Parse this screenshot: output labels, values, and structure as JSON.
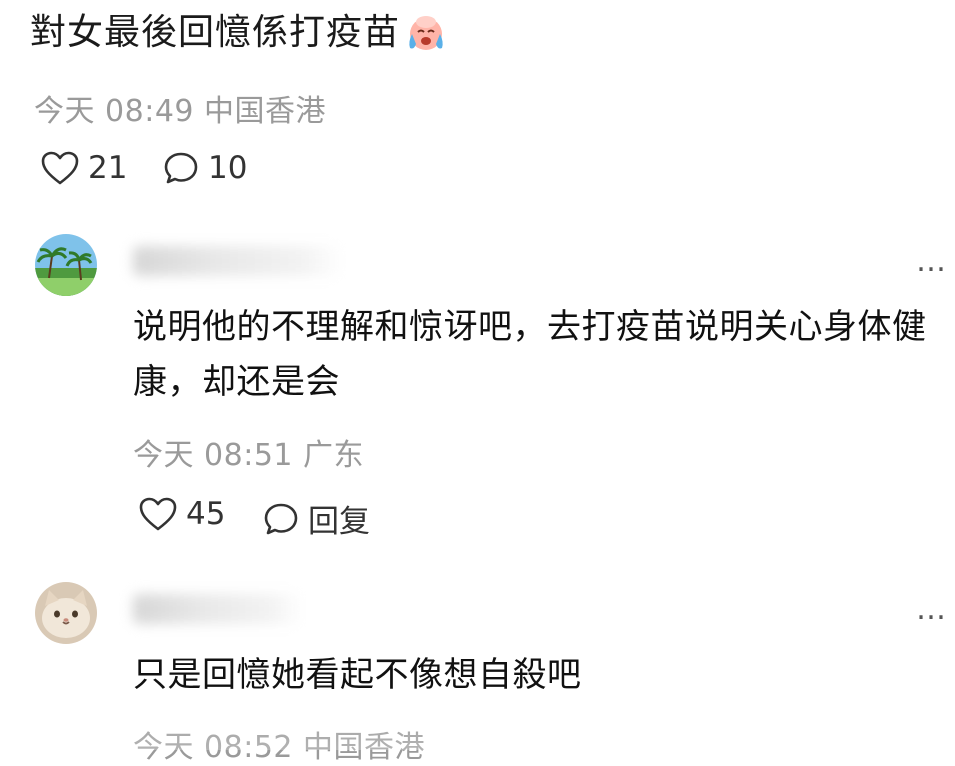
{
  "post": {
    "text": "對女最後回憶係打疫苗",
    "time": "今天 08:49",
    "location": "中国香港",
    "likes": "21",
    "comments": "10"
  },
  "comments": [
    {
      "text": "说明他的不理解和惊讶吧，去打疫苗说明关心身体健康，却还是会",
      "time": "今天 08:51",
      "location": "广东",
      "likes": "45",
      "reply_label": "回复",
      "more": "…"
    },
    {
      "text": "只是回憶她看起不像想自殺吧",
      "time": "今天 08:52",
      "location": "中国香港",
      "more": "…"
    }
  ]
}
